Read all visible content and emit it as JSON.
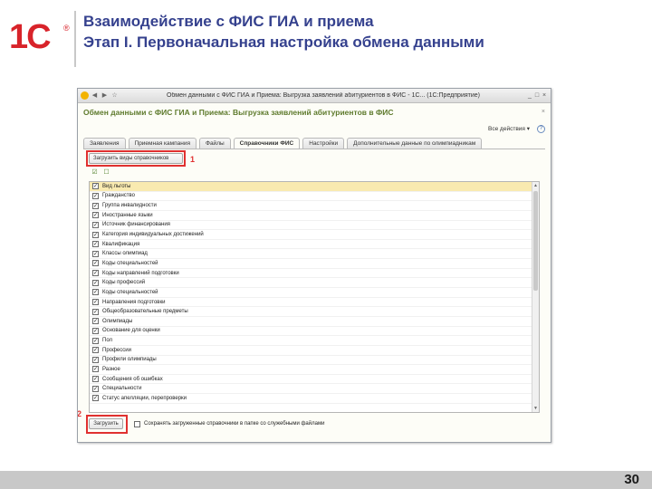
{
  "slide": {
    "logo_text": "1С",
    "logo_registered": "®",
    "title_line1": "Взаимодействие с ФИС ГИА и приема",
    "title_line2": "Этап I. Первоначальная настройка обмена данными",
    "page_number": "30"
  },
  "window": {
    "title": "Обмен данными с ФИС ГИА и Приема: Выгрузка заявлений абитуриентов в ФИС - 1С... (1С:Предприятие)",
    "controls": [
      "_",
      "□",
      "×"
    ],
    "toolbar_icons": [
      "app-icon",
      "back-icon",
      "forward-icon",
      "star-icon"
    ]
  },
  "form": {
    "title": "Обмен данными с ФИС ГИА и Приема: Выгрузка заявлений абитуриентов в ФИС",
    "actions_label": "Все действия ▾",
    "help_symbol": "?",
    "close_symbol": "×",
    "tabs": [
      {
        "label": "Заявления",
        "active": false
      },
      {
        "label": "Приемная кампания",
        "active": false
      },
      {
        "label": "Файлы",
        "active": false
      },
      {
        "label": "Справочники ФИС",
        "active": true
      },
      {
        "label": "Настройки",
        "active": false
      },
      {
        "label": "Дополнительные данные по олимпиадникам",
        "active": false
      }
    ],
    "load_button_label": "Загрузить виды справочников",
    "callout_1": "1",
    "callout_2": "2",
    "mini_toolbar_icons": [
      "check-all-icon",
      "uncheck-all-icon"
    ],
    "list_items": [
      {
        "label": "Вид льготы",
        "checked": true,
        "selected": true
      },
      {
        "label": "Гражданство",
        "checked": true
      },
      {
        "label": "Группа инвалидности",
        "checked": true
      },
      {
        "label": "Иностранные языки",
        "checked": true
      },
      {
        "label": "Источник финансирования",
        "checked": true
      },
      {
        "label": "Категория индивидуальных достижений",
        "checked": true
      },
      {
        "label": "Квалификация",
        "checked": true
      },
      {
        "label": "Классы олимпиад",
        "checked": true
      },
      {
        "label": "Коды специальностей",
        "checked": true
      },
      {
        "label": "Коды направлений подготовки",
        "checked": true
      },
      {
        "label": "Коды профессий",
        "checked": true
      },
      {
        "label": "Коды специальностей",
        "checked": true
      },
      {
        "label": "Направления подготовки",
        "checked": true
      },
      {
        "label": "Общеобразовательные предметы",
        "checked": true
      },
      {
        "label": "Олимпиады",
        "checked": true
      },
      {
        "label": "Основание для оценки",
        "checked": true
      },
      {
        "label": "Пол",
        "checked": true
      },
      {
        "label": "Профессии",
        "checked": true
      },
      {
        "label": "Профили олимпиады",
        "checked": true
      },
      {
        "label": "Разное",
        "checked": true
      },
      {
        "label": "Сообщения об ошибках",
        "checked": true
      },
      {
        "label": "Специальности",
        "checked": true
      },
      {
        "label": "Статус апелляции, перепроверки",
        "checked": true
      }
    ],
    "upload_button_label": "Загрузить",
    "save_files_label": "Сохранять загруженные справочники в папке со служебными файлами"
  },
  "colors": {
    "title_blue": "#35418e",
    "logo_red": "#d8232a",
    "form_title_green": "#5e7a2c",
    "callout_red": "#e03030",
    "selected_row": "#f9eab0"
  }
}
